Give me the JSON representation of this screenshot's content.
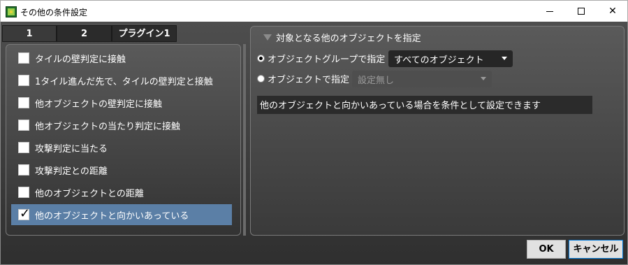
{
  "window": {
    "title": "その他の条件設定",
    "minimize_icon": "minimize-icon",
    "maximize_icon": "maximize-icon",
    "close_label": "✕"
  },
  "tabs": [
    {
      "label": "1"
    },
    {
      "label": "2"
    },
    {
      "label": "プラグイン1"
    }
  ],
  "conditions": [
    {
      "label": "タイルの壁判定に接触",
      "checked": false
    },
    {
      "label": "1タイル進んだ先で、タイルの壁判定と接触",
      "checked": false
    },
    {
      "label": "他オブジェクトの壁判定に接触",
      "checked": false
    },
    {
      "label": "他オブジェクトの当たり判定に接触",
      "checked": false
    },
    {
      "label": "攻撃判定に当たる",
      "checked": false
    },
    {
      "label": "攻撃判定との距離",
      "checked": false
    },
    {
      "label": "他のオブジェクトとの距離",
      "checked": false
    },
    {
      "label": "他のオブジェクトと向かいあっている",
      "checked": true
    }
  ],
  "detail": {
    "header": "対象となる他のオブジェクトを指定",
    "group_radio_label": "オブジェクトグループで指定",
    "group_select_value": "すべてのオブジェクト",
    "object_radio_label": "オブジェクトで指定",
    "object_select_value": "設定無し",
    "description": "他のオブジェクトと向かいあっている場合を条件として設定できます"
  },
  "footer": {
    "ok_label": "OK",
    "cancel_label": "キャンセル"
  },
  "colors": {
    "selected_row": "#5b7fa6",
    "panel_dark": "#2b2b2b"
  }
}
